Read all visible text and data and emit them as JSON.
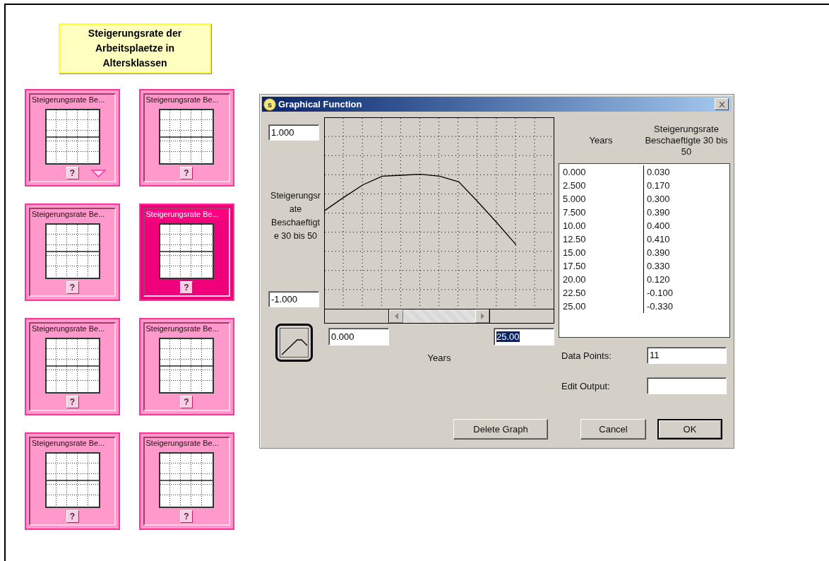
{
  "banner": {
    "title": "Steigerungsrate der Arbeitsplaetze in Altersklassen"
  },
  "cards": [
    {
      "title": "Steigerungsrate Be...",
      "help": "?",
      "selected": false,
      "dropdown": true
    },
    {
      "title": "Steigerungsrate Be...",
      "help": "?",
      "selected": false,
      "dropdown": false
    },
    {
      "title": "Steigerungsrate Be...",
      "help": "?",
      "selected": false,
      "dropdown": false
    },
    {
      "title": "Steigerungsrate Be...",
      "help": "?",
      "selected": true,
      "dropdown": false
    },
    {
      "title": "Steigerungsrate Be...",
      "help": "?",
      "selected": false,
      "dropdown": false
    },
    {
      "title": "Steigerungsrate Be...",
      "help": "?",
      "selected": false,
      "dropdown": false
    },
    {
      "title": "Steigerungsrate Be...",
      "help": "?",
      "selected": false,
      "dropdown": false
    },
    {
      "title": "Steigerungsrate Be...",
      "help": "?",
      "selected": false,
      "dropdown": false
    }
  ],
  "dialog": {
    "title": "Graphical Function",
    "icon_glyph": "s",
    "y_max": "1.000",
    "y_min": "-1.000",
    "y_label_lines": [
      "Steigerungsr",
      "ate",
      "Beschaeftigt",
      "e 30 bis 50"
    ],
    "x_min": {
      "value": "0.000",
      "highlighted": false
    },
    "x_max": {
      "value": "25.00",
      "highlighted": true
    },
    "x_label": "Years",
    "table": {
      "columns": [
        "Years",
        "Steigerungsrate Beschaeftigte 30 bis 50"
      ],
      "rows": [
        [
          "0.000",
          "0.030"
        ],
        [
          "2.500",
          "0.170"
        ],
        [
          "5.000",
          "0.300"
        ],
        [
          "7.500",
          "0.390"
        ],
        [
          "10.00",
          "0.400"
        ],
        [
          "12.50",
          "0.410"
        ],
        [
          "15.00",
          "0.390"
        ],
        [
          "17.50",
          "0.330"
        ],
        [
          "20.00",
          "0.120"
        ],
        [
          "22.50",
          "-0.100"
        ],
        [
          "25.00",
          "-0.330"
        ]
      ]
    },
    "data_points_label": "Data Points:",
    "data_points": "11",
    "edit_output_label": "Edit Output:",
    "buttons": [
      {
        "label": "Delete Graph",
        "default": false
      },
      {
        "label": "Cancel",
        "default": false
      },
      {
        "label": "OK",
        "default": true
      }
    ]
  }
}
